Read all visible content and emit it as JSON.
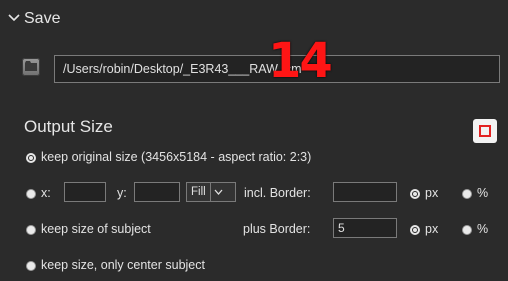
{
  "save": {
    "title": "Save",
    "path_value": "/Users/robin/Desktop/_E3R43___RAW_cm"
  },
  "badge": "14",
  "output_size": {
    "title": "Output Size",
    "options": {
      "keep_original": "keep original size (3456x5184 - aspect ratio: 2:3)",
      "keep_subject": "keep size of subject",
      "center_subject": "keep size, only center subject"
    },
    "x_label": "x:",
    "y_label": "y:",
    "x_value": "",
    "y_value": "",
    "fill_value": "Fill",
    "incl_border_label": "incl. Border:",
    "incl_border_value": "",
    "plus_border_label": "plus Border:",
    "plus_border_value": "5",
    "unit_px": "px",
    "unit_pct": "%"
  },
  "icons": {
    "chevron": "chevron-down-icon",
    "folder": "folder-icon",
    "stop": "stop-icon"
  },
  "colors": {
    "background": "#2b2b2b",
    "badge": "#ff1515",
    "stop_accent": "#e32222"
  }
}
